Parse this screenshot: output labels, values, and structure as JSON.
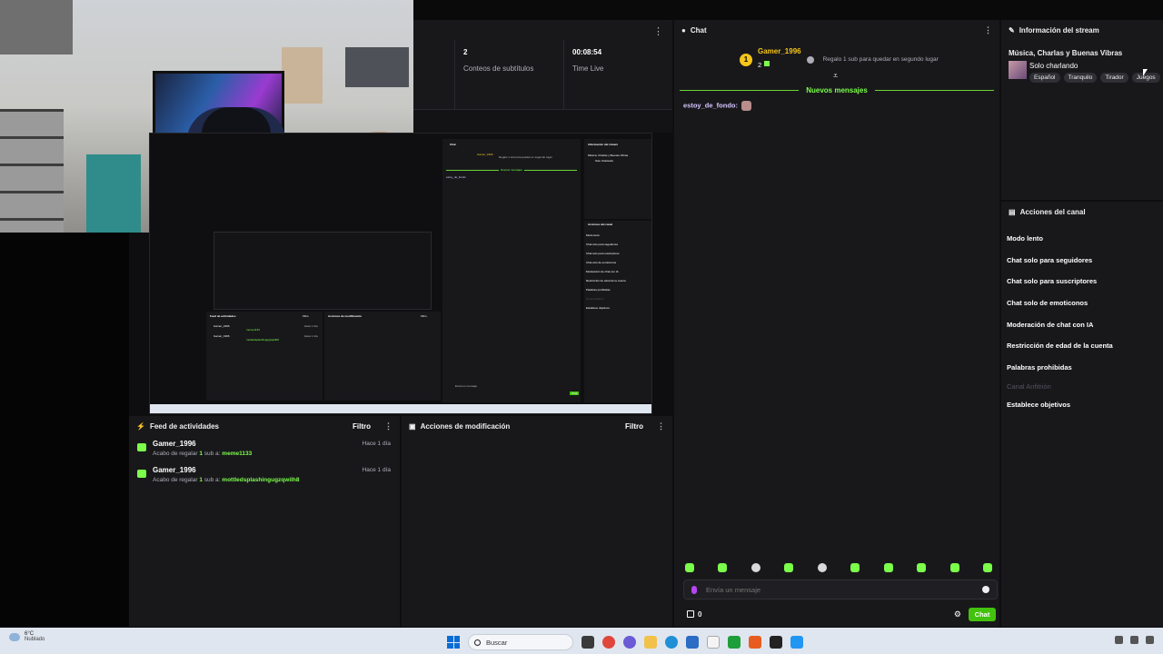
{
  "stats": {
    "subtitle_count": "2",
    "subtitle_label": "Conteos de subtítulos",
    "time_value": "00:08:54",
    "time_label": "Time Live"
  },
  "feed": {
    "title": "Feed de actividades",
    "filter": "Filtro",
    "items": [
      {
        "user": "Gamer_1996",
        "prefix": "Acabo de regalar",
        "count": "1",
        "mid": "sub a:",
        "target": "meme1133",
        "time": "Hace 1 día"
      },
      {
        "user": "Gamer_1996",
        "prefix": "Acabo de regalar",
        "count": "1",
        "mid": "sub a:",
        "target": "mottledsplashingugzqwilh8",
        "time": "Hace 1 día"
      }
    ]
  },
  "mod": {
    "title": "Acciones de modificación",
    "filter": "Filtro"
  },
  "chat": {
    "title": "Chat",
    "pinned": {
      "user": "Gamer_1996",
      "level": "1",
      "count": "2",
      "message": "Regalo 1 sub para quedar en segundo lugar"
    },
    "new_messages": "Nuevos mensajes",
    "message_user": "estoy_de_fondo:",
    "input_placeholder": "Envía un mensaje",
    "points": "0",
    "send_label": "Chat"
  },
  "info": {
    "title": "Información del stream",
    "stream_title": "Música, Charlas y Buenas Vibras",
    "category": "Solo charlando",
    "tags": [
      "Español",
      "Tranquilo",
      "Tirador",
      "Juegos"
    ]
  },
  "actions": {
    "title": "Acciones del canal",
    "items": [
      "Modo lento",
      "Chat solo para seguidores",
      "Chat solo para suscriptores",
      "Chat solo de emoticonos",
      "Moderación de chat con IA",
      "Restricción de edad de la cuenta",
      "Palabras prohibidas",
      "Canal Anfitrión",
      "Establece objetivos"
    ]
  },
  "preview": {
    "chat_title": "Chat",
    "info_title": "Información del stream",
    "stream_title": "Música, Charlas y Buenas Vibras",
    "category": "Solo charlando",
    "new_messages": "Nuevos mensajes",
    "message_user": "estoy_de_fondo:",
    "actions_title": "Acciones del canal",
    "actions": [
      "Modo lento",
      "Chat solo para seguidores",
      "Chat solo para suscriptores",
      "Chat solo de emoticonos",
      "Moderación de chat con IA",
      "Restricción de edad de la cuenta",
      "Palabras prohibidas",
      "Canal Anfitrión",
      "Establece objetivos"
    ],
    "feed_title": "Feed de actividades",
    "mod_title": "Acciones de modificación",
    "filter": "Filtro",
    "feed_user": "Gamer_1996",
    "feed_target1": "meme1133",
    "feed_target2": "mottledsplashingugzqwilh8",
    "time": "Hace 1 día",
    "input_placeholder": "Envía un mensaje",
    "send_label": "Chat",
    "pinned_user": "Gamer_1996",
    "pinned_msg": "Regalo 1 sub para quedar en segundo lugar"
  },
  "taskbar": {
    "temperature": "6°C",
    "condition": "Nublado",
    "search_label": "Buscar"
  },
  "colors": {
    "accent": "#7cff4a",
    "button": "#43c20d",
    "gold": "#f5c518",
    "panel": "#18181b"
  }
}
